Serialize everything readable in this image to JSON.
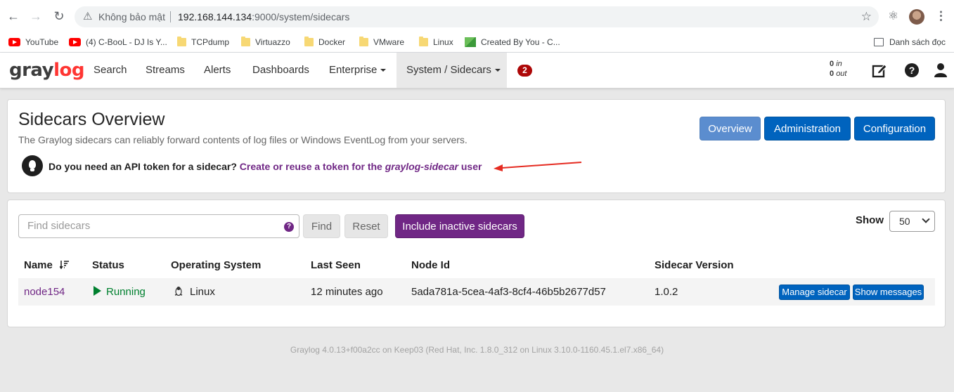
{
  "browser": {
    "security_warning": "Không bảo mật",
    "url_host": "192.168.144.134",
    "url_path": ":9000/system/sidecars",
    "bookmarks": [
      {
        "label": "YouTube",
        "icon": "youtube-icon"
      },
      {
        "label": "(4) C-BooL - DJ Is Y...",
        "icon": "youtube-icon"
      },
      {
        "label": "TCPdump",
        "icon": "folder-icon"
      },
      {
        "label": "Virtuazzo",
        "icon": "folder-icon"
      },
      {
        "label": "Docker",
        "icon": "folder-icon"
      },
      {
        "label": "VMware",
        "icon": "folder-icon"
      },
      {
        "label": "Linux",
        "icon": "folder-icon"
      },
      {
        "label": "Created By You - C...",
        "icon": "created-by-you-icon"
      }
    ],
    "reading_list": "Danh sách đọc"
  },
  "nav": {
    "logo_gray": "gray",
    "logo_log": "log",
    "items": [
      "Search",
      "Streams",
      "Alerts",
      "Dashboards",
      "Enterprise",
      "System / Sidecars"
    ],
    "notification_count": "2",
    "throughput_in_value": "0",
    "throughput_in_label": "in",
    "throughput_out_value": "0",
    "throughput_out_label": "out"
  },
  "header": {
    "title": "Sidecars Overview",
    "description": "The Graylog sidecars can reliably forward contents of log files or Windows EventLog from your servers.",
    "tip_question": "Do you need an API token for a sidecar?",
    "tip_link_prefix": "Create or reuse a token for the",
    "tip_link_user": "graylog-sidecar",
    "tip_link_suffix": "user",
    "buttons": [
      "Overview",
      "Administration",
      "Configuration"
    ]
  },
  "filter": {
    "search_placeholder": "Find sidecars",
    "find_label": "Find",
    "reset_label": "Reset",
    "include_inactive_label": "Include inactive sidecars",
    "show_label": "Show",
    "show_value": "50"
  },
  "table": {
    "headers": [
      "Name",
      "Status",
      "Operating System",
      "Last Seen",
      "Node Id",
      "Sidecar Version"
    ],
    "rows": [
      {
        "name": "node154",
        "status": "Running",
        "os": "Linux",
        "last_seen": "12 minutes ago",
        "node_id": "5ada781a-5cea-4af3-8cf4-46b5b2677d57",
        "version": "1.0.2",
        "manage_label": "Manage sidecar",
        "messages_label": "Show messages"
      }
    ]
  },
  "footer": {
    "text": "Graylog 4.0.13+f00a2cc on Keep03 (Red Hat, Inc. 1.8.0_312 on Linux 3.10.0-1160.45.1.el7.x86_64)"
  },
  "colors": {
    "brand_red": "#ff3633",
    "primary_blue": "#0063be",
    "purple": "#702785",
    "running_green": "#00802f"
  }
}
